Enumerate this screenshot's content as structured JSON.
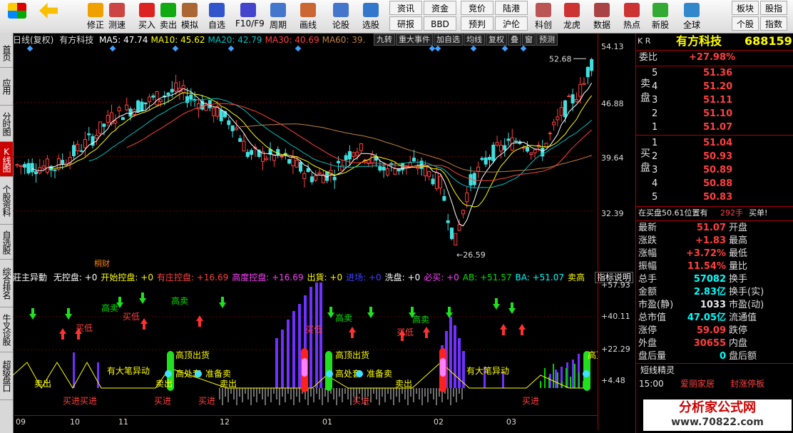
{
  "toolbar": {
    "buttons": [
      {
        "label": "修正"
      },
      {
        "label": "测速"
      },
      {
        "label": "买入"
      },
      {
        "label": "卖出"
      },
      {
        "label": "模拟"
      },
      {
        "label": "自选"
      },
      {
        "label": "F10/F9"
      },
      {
        "label": "周期"
      },
      {
        "label": "画线"
      },
      {
        "label": "论股"
      },
      {
        "label": "选股"
      },
      {
        "label": "科创"
      },
      {
        "label": "龙虎"
      },
      {
        "label": "数据"
      },
      {
        "label": "热点"
      },
      {
        "label": "新股"
      },
      {
        "label": "全球"
      }
    ],
    "small": [
      "资讯",
      "资金",
      "竞价",
      "陆港",
      "研报",
      "BBD",
      "预判",
      "沪伦",
      "板块",
      "股指",
      "个股",
      "指数"
    ]
  },
  "sidebar": [
    "首页",
    "应用",
    "分时图",
    "K线图",
    "个股资料",
    "自选股",
    "综合排名",
    "牛叉诊股",
    "超级盘口"
  ],
  "main": {
    "period": "日线(复权)",
    "stock": "有方科技",
    "ma": [
      {
        "label": "MA5: 47.74",
        "color": "#ffffff"
      },
      {
        "label": "MA10: 45.62",
        "color": "#ffff00"
      },
      {
        "label": "MA20: 42.79",
        "color": "#00c0c0"
      },
      {
        "label": "MA30: 40.69",
        "color": "#ff4040"
      },
      {
        "label": "MA60: 39.",
        "color": "#c08040"
      }
    ],
    "buttons": [
      "九转",
      "重大事件",
      "加自选",
      "均线",
      "复权",
      "叠",
      "窗",
      "预测"
    ],
    "high_label": "52.68",
    "low_label": "26.59",
    "annotation": "桐财"
  },
  "price_axis": [
    "54.13",
    "46.88",
    "39.64",
    "32.39"
  ],
  "indicator": {
    "name": "莊主异動",
    "fields": [
      {
        "label": "无控盘: +0",
        "color": "#ffffff"
      },
      {
        "label": "开始控盘: +0",
        "color": "#ffff00"
      },
      {
        "label": "有庄控盘: +16.69",
        "color": "#ff4040"
      },
      {
        "label": "高度控盘: +16.69",
        "color": "#ff40ff"
      },
      {
        "label": "出貨: +0",
        "color": "#ffff00"
      },
      {
        "label": "进场: +0",
        "color": "#4040ff"
      },
      {
        "label": "洗盘: +0",
        "color": "#ffffff"
      },
      {
        "label": "必买: +0",
        "color": "#ff40ff"
      },
      {
        "label": "AB: +51.57",
        "color": "#00e000"
      },
      {
        "label": "BA: +51.07",
        "color": "#00ffff"
      },
      {
        "label": "卖高",
        "color": "#ffff00"
      }
    ],
    "help": "指标说明",
    "signals": [
      "高卖",
      "买低",
      "高顶出货",
      "高处套",
      "准备卖",
      "卖出",
      "买进",
      "有大笔异动",
      "卖低"
    ]
  },
  "indicator_axis": [
    "+57.93",
    "+40.11",
    "+22.29",
    "+4.48"
  ],
  "xaxis": [
    "09",
    "10",
    "11",
    "12",
    "01",
    "02",
    "03"
  ],
  "panel": {
    "code": "K R",
    "name": "有方科技",
    "code_num": "688159",
    "ratio_label": "委比",
    "ratio": "+27.98%",
    "sell_group": "卖盘",
    "buy_group": "买盘",
    "sell": [
      {
        "level": "5",
        "price": "51.36"
      },
      {
        "level": "4",
        "price": "51.20"
      },
      {
        "level": "3",
        "price": "51.11"
      },
      {
        "level": "2",
        "price": "51.10"
      },
      {
        "level": "1",
        "price": "51.07"
      }
    ],
    "buy": [
      {
        "level": "1",
        "price": "51.04"
      },
      {
        "level": "2",
        "price": "50.93"
      },
      {
        "level": "3",
        "price": "50.89"
      },
      {
        "level": "4",
        "price": "50.88"
      },
      {
        "level": "5",
        "price": "50.83"
      }
    ],
    "order_line": "在买盘50.61位置有",
    "order_vol": "292手",
    "order_type": "买单!",
    "stats": [
      {
        "l1": "最新",
        "v1": "51.07",
        "c1": "red",
        "l2": "开盘"
      },
      {
        "l1": "涨跌",
        "v1": "+1.83",
        "c1": "red",
        "l2": "最高"
      },
      {
        "l1": "涨幅",
        "v1": "+3.72%",
        "c1": "red",
        "l2": "最低"
      },
      {
        "l1": "振幅",
        "v1": "11.54%",
        "c1": "red",
        "l2": "量比"
      },
      {
        "l1": "总手",
        "v1": "57082",
        "c1": "cyn",
        "l2": "换手"
      },
      {
        "l1": "金额",
        "v1": "2.83亿",
        "c1": "cyn",
        "l2": "换手(实)"
      },
      {
        "l1": "市盈(静)",
        "v1": "1033",
        "c1": "wht",
        "l2": "市盈(动)"
      },
      {
        "l1": "总市值",
        "v1": "47.05亿",
        "c1": "cyn",
        "l2": "流通值"
      },
      {
        "l1": "涨停",
        "v1": "59.09",
        "c1": "red",
        "l2": "跌停"
      },
      {
        "l1": "外盘",
        "v1": "30655",
        "c1": "red",
        "l2": "内盘"
      },
      {
        "l1": "盘后量",
        "v1": "0",
        "c1": "cyn",
        "l2": "盘后额"
      }
    ],
    "news_title": "短线精灵",
    "news": [
      {
        "time": "15:00",
        "stock": "爱丽家居",
        "event": "封涨停板"
      }
    ]
  },
  "logo": {
    "text": "分析家公式网",
    "url": "www.70822.com"
  }
}
